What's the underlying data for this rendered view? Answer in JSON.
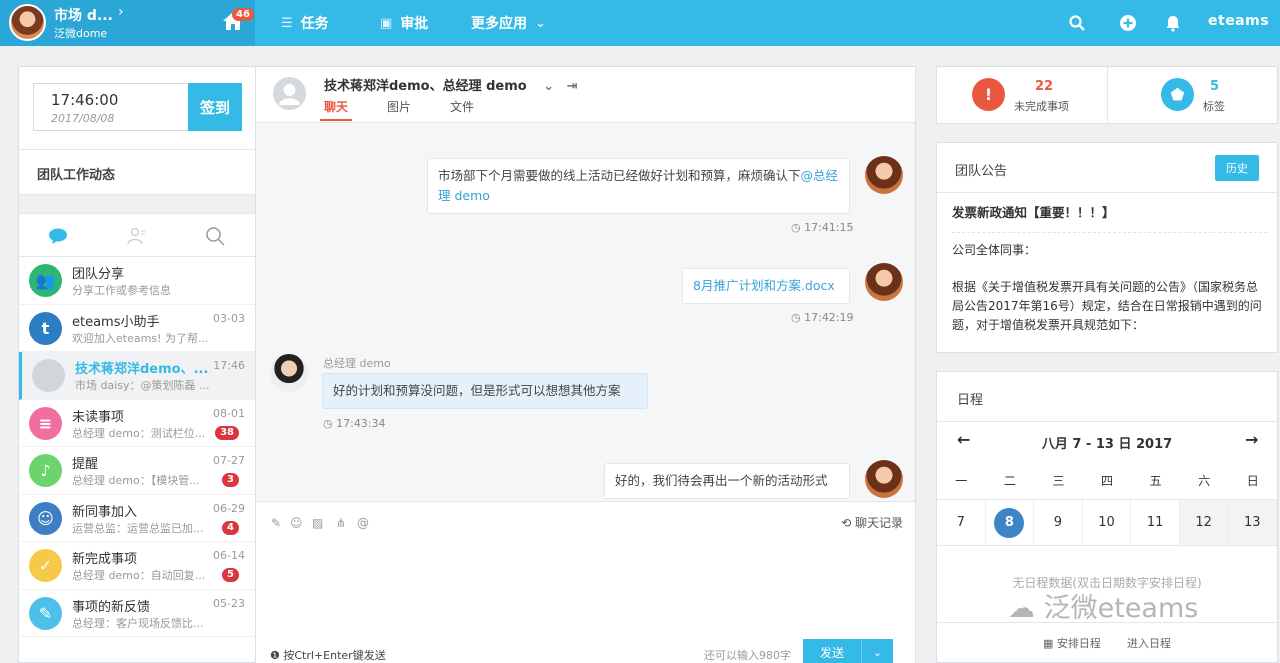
{
  "topbar": {
    "user_name": "市场 d...",
    "user_org": "泛微dome",
    "home_badge": "46",
    "nav": {
      "tasks": "任务",
      "approval": "审批",
      "more_apps": "更多应用"
    },
    "brand": "eteams"
  },
  "left": {
    "clock": {
      "time": "17:46:00",
      "date": "2017/08/08"
    },
    "signin_label": "签到",
    "team_dynamics": "团队工作动态",
    "conversations": [
      {
        "title": "团队分享",
        "sub": "分享工作或参考信息",
        "date": "",
        "badge": "",
        "color": "#2bb673",
        "glyph": "👥"
      },
      {
        "title": "eteams小助手",
        "sub": "欢迎加入eteams! 为了帮...",
        "date": "03-03",
        "badge": "",
        "color": "#2b7dc4",
        "glyph": "t"
      },
      {
        "title": "技术蒋郑洋demo、...",
        "sub": "市场 daisy：@策划陈磊 ...",
        "date": "17:46",
        "badge": "",
        "color": "#d3d6d9",
        "glyph": ""
      },
      {
        "title": "未读事项",
        "sub": "总经理 demo：测试栏位...",
        "date": "08-01",
        "badge": "38",
        "color": "#f06fa0",
        "glyph": "≡"
      },
      {
        "title": "提醒",
        "sub": "总经理 demo：【模块管...",
        "date": "07-27",
        "badge": "3",
        "color": "#6cd46c",
        "glyph": "♪"
      },
      {
        "title": "新同事加入",
        "sub": "运营总监：运营总监已加...",
        "date": "06-29",
        "badge": "4",
        "color": "#3e7fc4",
        "glyph": "☺"
      },
      {
        "title": "新完成事项",
        "sub": "总经理 demo：自动回复...",
        "date": "06-14",
        "badge": "5",
        "color": "#f7c948",
        "glyph": "✓"
      },
      {
        "title": "事项的新反馈",
        "sub": "总经理：客户现场反馈比...",
        "date": "05-23",
        "badge": "",
        "color": "#4cc0e8",
        "glyph": "✎"
      }
    ]
  },
  "chat": {
    "title": "技术蒋郑洋demo、总经理 demo",
    "tabs": [
      "聊天",
      "图片",
      "文件"
    ],
    "messages": {
      "m1_text": "市场部下个月需要做的线上活动已经做好计划和预算，麻烦确认下",
      "m1_mention": "@总经理 demo",
      "m1_time": "17:41:15",
      "m2_file": "8月推广计划和方案.docx",
      "m2_time": "17:42:19",
      "m3_sender": "总经理 demo",
      "m3_text": "好的计划和预算没问题，但是形式可以想想其他方案",
      "m3_time": "17:43:34",
      "m4_text": "好的，我们待会再出一个新的活动形式"
    },
    "chat_log": "聊天记录",
    "hint": "按Ctrl+Enter键发送",
    "remain": "还可以输入980字",
    "send": "发送"
  },
  "right": {
    "stats": [
      {
        "num": "22",
        "label": "未完成事项",
        "color": "#e9573f"
      },
      {
        "num": "5",
        "label": "标签",
        "color": "#35b9e6"
      }
    ],
    "notice": {
      "header": "团队公告",
      "history": "历史",
      "title": "发票新政通知【重要！！！】",
      "greeting": "公司全体同事：",
      "body": "根据《关于增值税发票开具有关问题的公告》（国家税务总局公告2017年第16号）规定，结合在日常报销中遇到的问题，对于增值税发票开具规范如下："
    },
    "schedule": {
      "header": "日程",
      "week": "八月 7 - 13 日  2017",
      "weekdays": [
        "一",
        "二",
        "三",
        "四",
        "五",
        "六",
        "日"
      ],
      "days": [
        "7",
        "8",
        "9",
        "10",
        "11",
        "12",
        "13"
      ],
      "today_index": 1,
      "empty": "无日程数据(双击日期数字安排日程)",
      "arrange": "安排日程",
      "enter": "进入日程"
    }
  },
  "watermark": "泛微eteams",
  "colors": {
    "primary": "#35b9e6",
    "alert": "#e9573f",
    "badge": "#d9363e"
  }
}
